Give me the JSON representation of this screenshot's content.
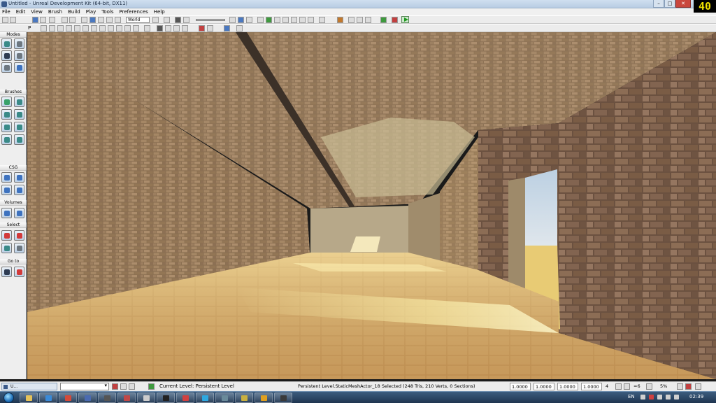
{
  "window": {
    "title": "Untitled - Unreal Development Kit (64-bit, DX11)",
    "minimize": "–",
    "maximize": "□",
    "close": "✕",
    "fps": "40"
  },
  "menu": [
    "File",
    "Edit",
    "View",
    "Brush",
    "Build",
    "Play",
    "Tools",
    "Preferences",
    "Help"
  ],
  "toolbar": {
    "coordinate_system": "World",
    "mode_label": "P"
  },
  "modes_panel": {
    "sections": [
      "Modes",
      "Brushes",
      "CSG",
      "Volumes",
      "Select",
      "Go to"
    ]
  },
  "statusbar": {
    "tab_label": "U...",
    "current_level_label": "Current Level:",
    "current_level_value": "Persistent Level",
    "selection_info": "Persistent Level.StaticMeshActor_18 Selected (248 Tris, 210 Verts, 0 Sections)",
    "drag_x": "1.0000",
    "drag_y": "1.0000",
    "drag_z": "1.0000",
    "drag_w": "1.0000",
    "grid_size": "4",
    "rotation_snap": "=6",
    "scale_snap": "5%"
  },
  "taskbar": {
    "language": "EN",
    "clock": "02:39"
  },
  "colors": {
    "wall": "#8a6a4c",
    "floor": "#c9a45a",
    "sky": "#a9c2d8",
    "desert": "#e7cb74",
    "fps_text": "#f0e000"
  }
}
